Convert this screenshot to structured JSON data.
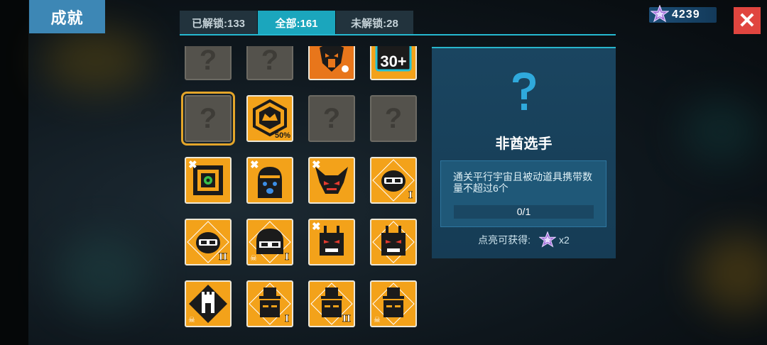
{
  "header": {
    "title": "成就"
  },
  "tabs": [
    {
      "label": "已解锁:133",
      "active": false
    },
    {
      "label": "全部:161",
      "active": true
    },
    {
      "label": "未解锁:28",
      "active": false
    }
  ],
  "currency": {
    "value": "4239",
    "icon": "star-gem-icon"
  },
  "close": {
    "icon": "close-icon"
  },
  "badges": [
    {
      "state": "locked",
      "icon": "question-mark-icon"
    },
    {
      "state": "locked",
      "icon": "question-mark-icon"
    },
    {
      "state": "unlocked",
      "icon": "demon-mask-icon"
    },
    {
      "state": "unlocked",
      "icon": "thirty-plus-icon",
      "label": "30+"
    },
    {
      "state": "locked",
      "icon": "question-mark-icon",
      "selected": true
    },
    {
      "state": "unlocked",
      "icon": "crown-hexagon-icon",
      "label": "50%"
    },
    {
      "state": "locked",
      "icon": "question-mark-icon"
    },
    {
      "state": "locked",
      "icon": "question-mark-icon"
    },
    {
      "state": "unlocked",
      "icon": "circuit-box-icon"
    },
    {
      "state": "unlocked",
      "icon": "crying-bell-icon"
    },
    {
      "state": "unlocked",
      "icon": "horned-demon-icon"
    },
    {
      "state": "unlocked",
      "icon": "goggle-head-icon",
      "tier": "I"
    },
    {
      "state": "unlocked",
      "icon": "goggle-head-icon",
      "tier": "II"
    },
    {
      "state": "unlocked",
      "icon": "capped-goggle-icon",
      "tier": "I"
    },
    {
      "state": "unlocked",
      "icon": "horned-robot-icon"
    },
    {
      "state": "unlocked",
      "icon": "horned-robot-icon"
    },
    {
      "state": "unlocked",
      "icon": "castle-tower-icon"
    },
    {
      "state": "unlocked",
      "icon": "top-hat-head-icon",
      "tier": "I"
    },
    {
      "state": "unlocked",
      "icon": "top-hat-head-icon",
      "tier": "II"
    },
    {
      "state": "unlocked",
      "icon": "top-hat-head-icon"
    }
  ],
  "detail": {
    "name": "非酋选手",
    "description": "通关平行宇宙且被动道具携带数量不超过6个",
    "progress": "0/1",
    "reward_label": "点亮可获得:",
    "reward_amount": "x2",
    "reward_icon": "star-gem-icon"
  },
  "colors": {
    "accent": "#1ba6bd",
    "badge": "#f3a21a",
    "close": "#e0453f",
    "title": "#3d87b5"
  }
}
